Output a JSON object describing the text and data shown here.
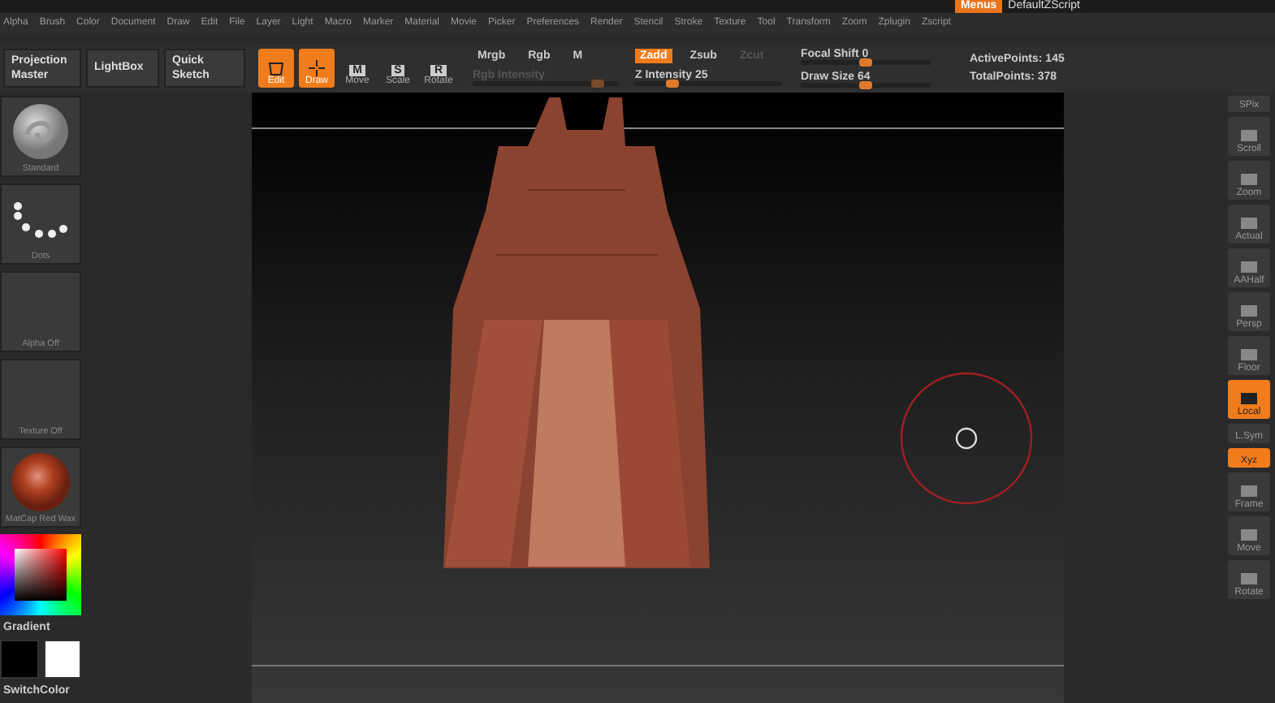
{
  "title_bar": {
    "menus_button": "Menus",
    "script_name": "DefaultZScript"
  },
  "menu_bar": [
    "Alpha",
    "Brush",
    "Color",
    "Document",
    "Draw",
    "Edit",
    "File",
    "Layer",
    "Light",
    "Macro",
    "Marker",
    "Material",
    "Movie",
    "Picker",
    "Preferences",
    "Render",
    "Stencil",
    "Stroke",
    "Texture",
    "Tool",
    "Transform",
    "Zoom",
    "Zplugin",
    "Zscript"
  ],
  "toolbar": {
    "panels": [
      {
        "label": "Projection Master"
      },
      {
        "label": "LightBox"
      },
      {
        "label": "Quick Sketch"
      }
    ],
    "modes": [
      {
        "kind": "mode",
        "label": "Edit",
        "selected": true
      },
      {
        "kind": "mode",
        "label": "Draw",
        "selected": true
      },
      {
        "kind": "transform",
        "label": "Move",
        "key": "M",
        "selected": false
      },
      {
        "kind": "transform",
        "label": "Scale",
        "key": "S",
        "selected": false
      },
      {
        "kind": "transform",
        "label": "Rotate",
        "key": "R",
        "selected": false
      }
    ],
    "color_modes": [
      {
        "label": "Mrgb",
        "selected": false
      },
      {
        "label": "Rgb",
        "selected": false
      },
      {
        "label": "M",
        "selected": false
      }
    ],
    "rgb_intensity": {
      "label": "Rgb Intensity",
      "disabled": true,
      "level": 0.85
    },
    "depth_modes": [
      {
        "label": "Zadd",
        "selected": true,
        "disabled": false
      },
      {
        "label": "Zsub",
        "selected": false,
        "disabled": false
      },
      {
        "label": "Zcut",
        "selected": false,
        "disabled": true
      }
    ],
    "z_intensity": {
      "label": "Z Intensity 25",
      "level": 0.25
    },
    "focal_shift": {
      "label": "Focal Shift 0",
      "level": 0.5
    },
    "draw_size": {
      "label": "Draw Size 64",
      "level": 0.5
    },
    "active_points": "ActivePoints: 145",
    "total_points": "TotalPoints: 378"
  },
  "left_shelf": [
    {
      "kind": "brush",
      "label": "Standard"
    },
    {
      "kind": "stroke",
      "label": "Dots"
    },
    {
      "kind": "empty",
      "label": "Alpha Off"
    },
    {
      "kind": "empty",
      "label": "Texture Off"
    },
    {
      "kind": "material",
      "label": "MatCap Red Wax"
    }
  ],
  "color_picker": {
    "gradient_label": "Gradient",
    "switch_label": "SwitchColor",
    "swatches": [
      {
        "color": "#000000"
      },
      {
        "color": "#ffffff"
      }
    ]
  },
  "right_shelf": [
    {
      "kind": "slider",
      "label": "SPix",
      "selected": false
    },
    {
      "kind": "button",
      "label": "Scroll",
      "selected": false
    },
    {
      "kind": "button",
      "label": "Zoom",
      "selected": false
    },
    {
      "kind": "button",
      "label": "Actual",
      "selected": false
    },
    {
      "kind": "button",
      "label": "AAHalf",
      "selected": false
    },
    {
      "kind": "button",
      "label": "Persp",
      "selected": false
    },
    {
      "kind": "button",
      "label": "Floor",
      "selected": false
    },
    {
      "kind": "button",
      "label": "Local",
      "selected": true
    },
    {
      "kind": "small",
      "label": "L.Sym",
      "selected": false
    },
    {
      "kind": "small",
      "label": "Xyz",
      "selected": true
    },
    {
      "kind": "button",
      "label": "Frame",
      "selected": false
    },
    {
      "kind": "button",
      "label": "Move",
      "selected": false
    },
    {
      "kind": "button",
      "label": "Rotate",
      "selected": false
    }
  ]
}
